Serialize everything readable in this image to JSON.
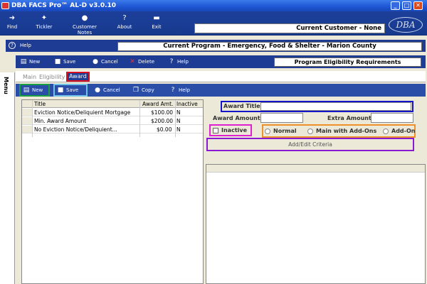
{
  "window": {
    "title": "DBA FACS Pro™ AL-D v3.0.10",
    "min": "_",
    "max": "□",
    "close": "✕"
  },
  "main_toolbar": {
    "items": [
      {
        "label": "Find",
        "icon": "find-icon"
      },
      {
        "label": "Tickler",
        "icon": "tickler-icon"
      },
      {
        "label": "Customer Notes",
        "icon": "customer-notes-icon"
      },
      {
        "label": "About",
        "icon": "about-icon"
      },
      {
        "label": "Exit",
        "icon": "exit-icon"
      }
    ],
    "current_customer": "Current Customer - None",
    "logo_text": "DBA"
  },
  "help_bar": {
    "help_label": "Help",
    "current_program": "Current Program - Emergency, Food & Shelter - Marion County"
  },
  "side_menu": {
    "label": "Menu"
  },
  "program_toolbar": {
    "new": "New",
    "save": "Save",
    "cancel": "Cancel",
    "delete": "Delete",
    "help": "Help",
    "section": "Program Eligibility Requirements"
  },
  "tabs": [
    {
      "label": "Main"
    },
    {
      "label": "Eligibility"
    },
    {
      "label": "Award"
    }
  ],
  "award_toolbar": {
    "new": "New",
    "save": "Save",
    "cancel": "Cancel",
    "copy": "Copy",
    "help": "Help"
  },
  "grid": {
    "columns": [
      "Title",
      "Award Amt.",
      "Inactive"
    ],
    "rows": [
      {
        "title": "Eviction Notice/Deliquient Mortgage",
        "amount": "$100.00",
        "inactive": "N"
      },
      {
        "title": "Min. Award Amount",
        "amount": "$200.00",
        "inactive": "N"
      },
      {
        "title": "No Eviction Notice/Deliquient...",
        "amount": "$0.00",
        "inactive": "N"
      }
    ]
  },
  "form": {
    "award_title_label": "Award Title",
    "award_title_value": "",
    "award_amount_label": "Award Amount",
    "award_amount_value": "",
    "extra_amount_label": "Extra Amount",
    "extra_amount_value": "",
    "inactive_label": "Inactive",
    "radio_options": [
      "Normal",
      "Main with Add-Ons",
      "Add-On"
    ],
    "criteria_button": "Add/Edit Criteria"
  },
  "colors": {
    "toolbar": "#1f3c95",
    "highlight_red": "#d81020",
    "highlight_green": "#1aa040",
    "highlight_blue": "#1414c8",
    "highlight_magenta": "#e020d0",
    "highlight_orange": "#f0902a",
    "highlight_purple": "#8a1ad0"
  }
}
